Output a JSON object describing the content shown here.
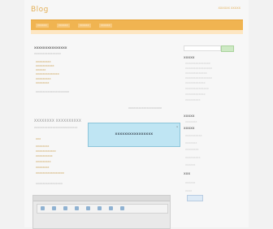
{
  "header": {
    "logo": "Blog",
    "right_text": "XXXXXX XXXXX"
  },
  "nav": {
    "items": [
      "XXXXXX",
      "XXXXXX",
      "XXXXXX",
      "XXXXXX"
    ]
  },
  "main": {
    "post1": {
      "title": "XXXXXXXXXXXXXXX",
      "meta": "XXXXXXXXXXXXXXXX",
      "lines": [
        "XXXXXXXXX",
        "XXXXXXXXXXX",
        "XXXXXX",
        "XXXXXXXXXXXXXX",
        "XXXXXXXXX",
        "XXXXXXXX",
        "XXXXXXXXXXXXXXXXXXXX"
      ],
      "footer": "XXXXXXXXXXXXXXXXXXXX"
    },
    "post2": {
      "title": "XXXXXXXX XXXXXXXXXX",
      "meta": "XXXXXXXXXXXXXXXXXXXXXXXXXX",
      "lines": [
        "XXX",
        "XXXXXXXX",
        "XXXXXXXXXXXX",
        "XXXXXXXXXX",
        "XXXXXXXXX",
        "XXXXXXXX",
        "XXXXXXXXXXXXXXXXX"
      ],
      "footer": "XXXXXXXXXXXXXXXX"
    }
  },
  "sidebar": {
    "search_button": "",
    "sections": [
      {
        "title": "XXXXX",
        "links": [
          "XXXXXXXXXXXXXXX",
          "XXXXXXXXXXXXXXXX",
          "XXXXXXXXXXXXX",
          "XXXXXXXXXXXXXXXX",
          "XXXXXXXXXXXX",
          "XXXXXXXXXXXXXX",
          "XXXXXXXXXXXX",
          "XXXXXXXXX"
        ]
      },
      {
        "title": "XXXXX",
        "links": [
          "XXXXXXX",
          "XXXXXXXXX"
        ]
      },
      {
        "title": "XXXXX",
        "links": [
          "XXXXXXXXXX",
          "XXXXXXX",
          "XXXXXXXX",
          "XXXXXXXXX",
          "XXXXXX"
        ]
      },
      {
        "title": "XXX",
        "links": [
          "XXXXXX",
          "XXXX"
        ]
      }
    ]
  },
  "dialog": {
    "label": "XXXXXXXXXXXXXXXX",
    "close": "x"
  }
}
